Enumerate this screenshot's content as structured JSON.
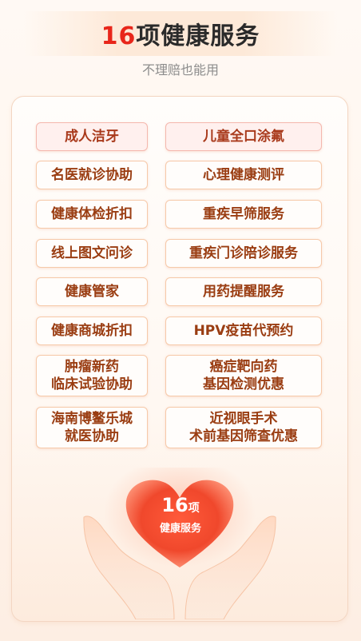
{
  "header": {
    "title_number": "16",
    "title_text": "项健康服务",
    "subtitle": "不理赔也能用"
  },
  "services": {
    "left": [
      "成人洁牙",
      "名医就诊协助",
      "健康体检折扣",
      "线上图文问诊",
      "健康管家",
      "健康商城折扣",
      "肿瘤新药\n临床试验协助",
      "海南博鳌乐城\n就医协助"
    ],
    "right": [
      "儿童全口涂氟",
      "心理健康测评",
      "重疾早筛服务",
      "重疾门诊陪诊服务",
      "用药提醒服务",
      "HPV疫苗代预约",
      "癌症靶向药\n基因检测优惠",
      "近视眼手术\n术前基因筛查优惠"
    ]
  },
  "heart_badge": {
    "number": "16",
    "unit": "项",
    "label": "健康服务"
  },
  "colors": {
    "accent_red": "#e8261a",
    "button_text": "#9a3d12",
    "button_border": "#f6c9a9"
  }
}
